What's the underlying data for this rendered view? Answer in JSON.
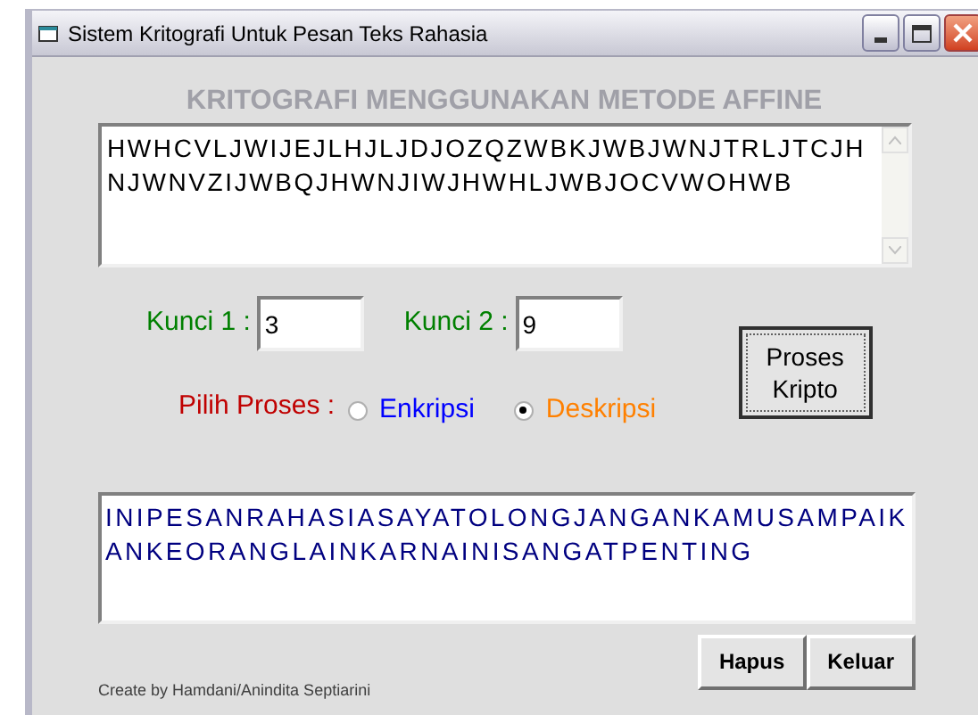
{
  "window": {
    "title": "Sistem Kritografi Untuk Pesan Teks Rahasia"
  },
  "heading": "KRITOGRAFI MENGGUNAKAN METODE AFFINE",
  "input_text": {
    "lines": [
      "HWHCVLJWIJEJLHJLJDJOZQZWBKJWBJWNJTRLJTCJH",
      "NJWNVZIJWBQJHWNJIWJHWHLJWBJOCVWOHWB"
    ]
  },
  "keys": [
    {
      "label": "Kunci 1 :",
      "value": "3"
    },
    {
      "label": "Kunci 2 :",
      "value": "9"
    }
  ],
  "process": {
    "label": "Pilih Proses :",
    "options": [
      {
        "label": "Enkripsi",
        "selected": false,
        "color": "#0000ff"
      },
      {
        "label": "Deskripsi",
        "selected": true,
        "color": "#ff8000"
      }
    ]
  },
  "process_button": {
    "lines": [
      "Proses",
      "Kripto"
    ]
  },
  "output_text": {
    "lines": [
      "INIPESANRAHASIASAYATOLONGJANGANKAMUSAMPAIK",
      "ANKEORANGLAINKARNAINISANGATPENTING"
    ]
  },
  "buttons": [
    "Hapus",
    "Keluar"
  ],
  "credit": "Create by Hamdani/Anindita Septiarini"
}
